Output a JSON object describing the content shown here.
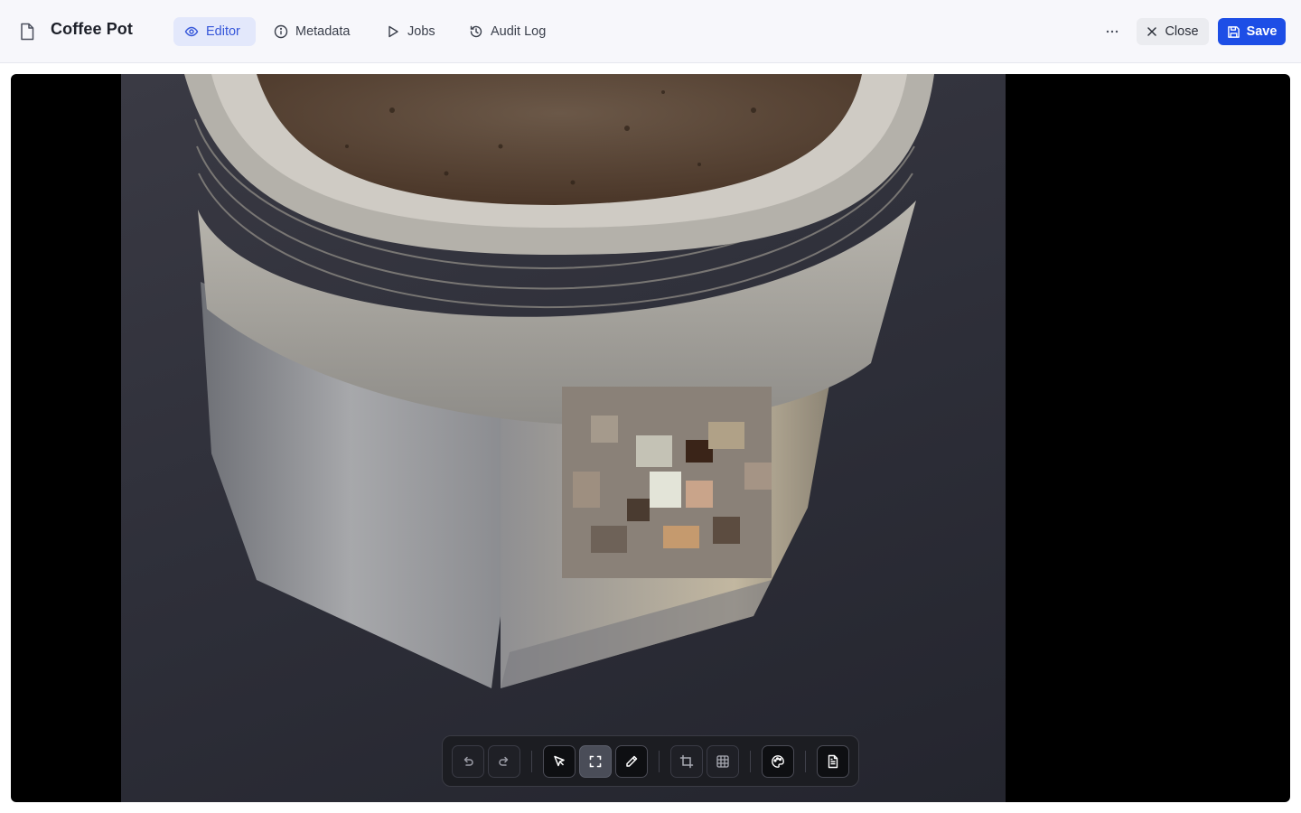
{
  "header": {
    "title": "Coffee Pot",
    "tabs": [
      {
        "label": "Editor",
        "icon": "eye-icon",
        "active": true
      },
      {
        "label": "Metadata",
        "icon": "info-icon",
        "active": false
      },
      {
        "label": "Jobs",
        "icon": "play-icon",
        "active": false
      },
      {
        "label": "Audit Log",
        "icon": "history-icon",
        "active": false
      }
    ],
    "close_label": "Close",
    "save_label": "Save"
  },
  "toolbar": {
    "tools": [
      "undo-icon",
      "redo-icon",
      "select-pointer-icon",
      "region-select-icon",
      "pencil-icon",
      "crop-icon",
      "grid-icon",
      "palette-icon",
      "document-icon"
    ],
    "active_tool": "region-select-icon"
  },
  "colors": {
    "accent": "#1d4ee6",
    "active_tab_bg": "#e3e8fb",
    "active_tab_text": "#3556d9",
    "canvas_bg": "#000000",
    "toolbar_bg": "#1c1d22"
  }
}
